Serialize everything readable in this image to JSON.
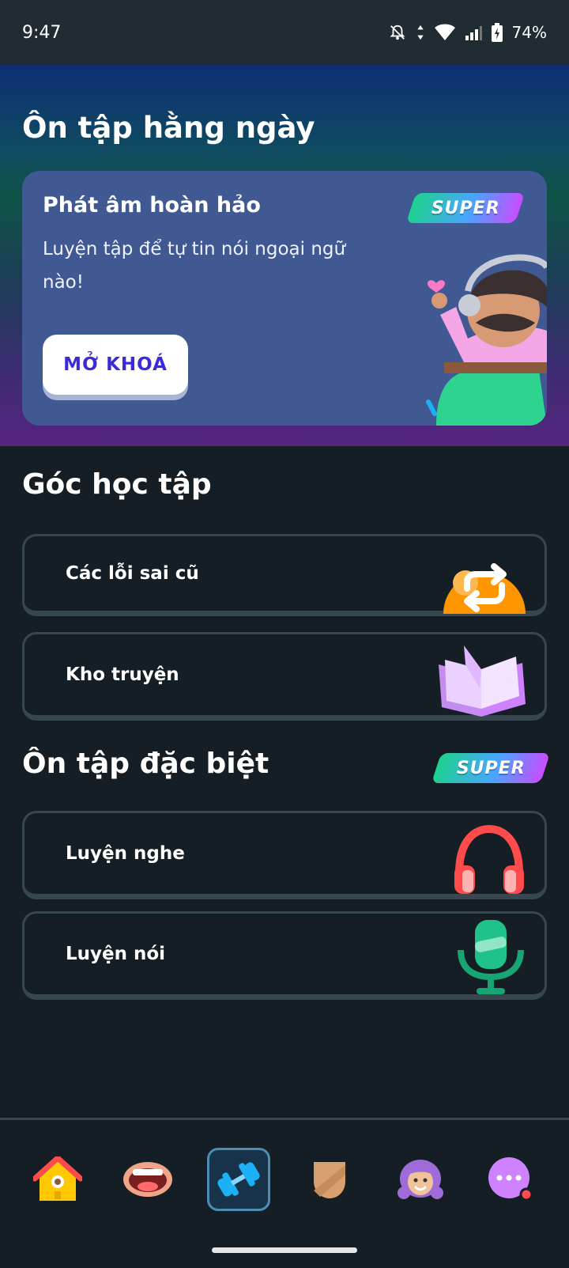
{
  "status_bar": {
    "time": "9:47",
    "battery": "74%"
  },
  "daily_review": {
    "title": "Ôn tập hằng ngày",
    "card": {
      "title": "Phát âm hoàn hảo",
      "description": "Luyện tập để tự tin nói ngoại ngữ nào!",
      "badge": "SUPER",
      "button_label": "MỞ KHOÁ"
    }
  },
  "study_corner": {
    "title": "Góc học tập",
    "items": [
      {
        "label": "Các lỗi sai cũ",
        "icon": "repeat-icon"
      },
      {
        "label": "Kho truyện",
        "icon": "book-icon"
      }
    ]
  },
  "special_review": {
    "title": "Ôn tập đặc biệt",
    "badge": "SUPER",
    "items": [
      {
        "label": "Luyện nghe",
        "icon": "headphones-icon"
      },
      {
        "label": "Luyện nói",
        "icon": "microphone-icon"
      }
    ]
  },
  "bottom_nav": {
    "items": [
      {
        "icon": "home-icon"
      },
      {
        "icon": "mouth-icon"
      },
      {
        "icon": "dumbbell-icon",
        "active": true
      },
      {
        "icon": "shield-icon"
      },
      {
        "icon": "profile-icon"
      },
      {
        "icon": "more-icon",
        "notification": true
      }
    ]
  },
  "colors": {
    "background": "#151e24",
    "card": "#405993",
    "button_text": "#3b2bd6",
    "border": "#37464f"
  }
}
